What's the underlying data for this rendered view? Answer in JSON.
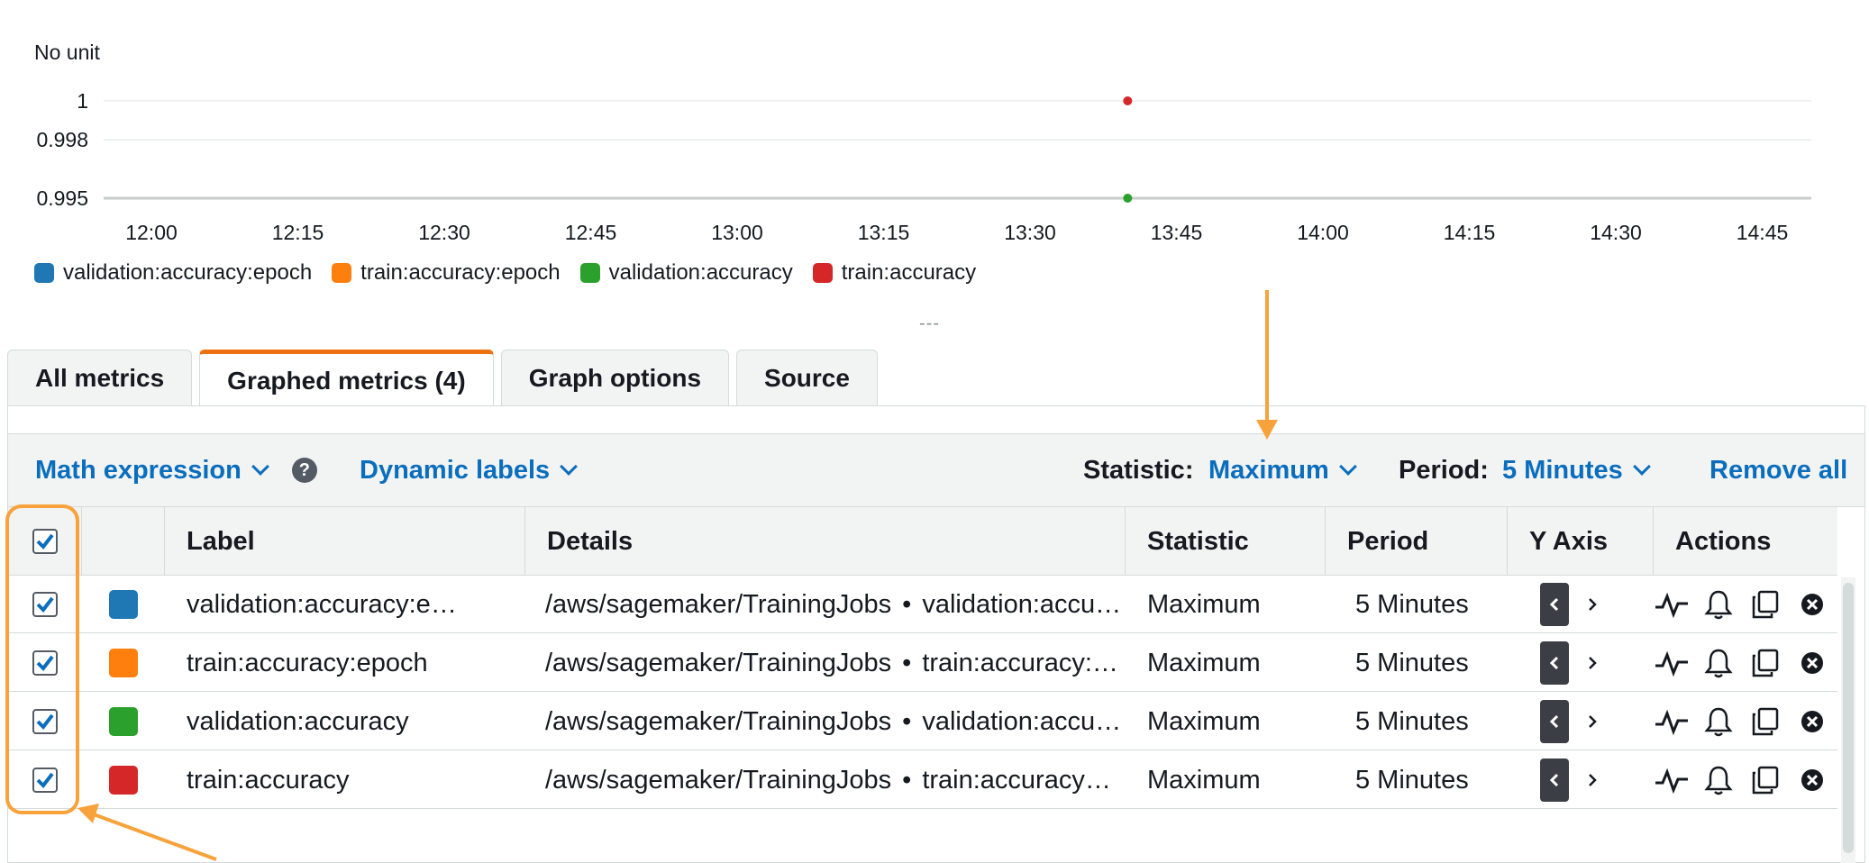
{
  "chart": {
    "unit_label": "No unit",
    "y_ticks": [
      "1",
      "0.998",
      "0.995"
    ],
    "x_ticks": [
      "12:00",
      "12:15",
      "12:30",
      "12:45",
      "13:00",
      "13:15",
      "13:30",
      "13:45",
      "14:00",
      "14:15",
      "14:30",
      "14:45"
    ]
  },
  "chart_data": {
    "type": "scatter",
    "x_ticks": [
      "12:00",
      "12:15",
      "12:30",
      "12:45",
      "13:00",
      "13:15",
      "13:30",
      "13:45",
      "14:00",
      "14:15",
      "14:30",
      "14:45"
    ],
    "y_ticks": [
      1,
      0.998,
      0.995
    ],
    "ylabel": "No unit",
    "series": [
      {
        "name": "validation:accuracy:epoch",
        "color": "#1f77b4",
        "points": []
      },
      {
        "name": "train:accuracy:epoch",
        "color": "#ff7f0e",
        "points": []
      },
      {
        "name": "validation:accuracy",
        "color": "#2ca02c",
        "points": [
          {
            "x": "13:40",
            "y": 0.995
          }
        ]
      },
      {
        "name": "train:accuracy",
        "color": "#d62728",
        "points": [
          {
            "x": "13:40",
            "y": 1
          }
        ]
      }
    ],
    "grid": true,
    "legend": "bottom-left"
  },
  "legend": [
    {
      "label": "validation:accuracy:epoch",
      "color": "#1f77b4"
    },
    {
      "label": "train:accuracy:epoch",
      "color": "#ff7f0e"
    },
    {
      "label": "validation:accuracy",
      "color": "#2ca02c"
    },
    {
      "label": "train:accuracy",
      "color": "#d62728"
    }
  ],
  "resize_grip": "---",
  "tabs": [
    {
      "label": "All metrics"
    },
    {
      "label": "Graphed metrics (4)"
    },
    {
      "label": "Graph options"
    },
    {
      "label": "Source"
    }
  ],
  "toolbar": {
    "math_expression": "Math expression",
    "dynamic_labels": "Dynamic labels",
    "statistic_label": "Statistic:",
    "statistic_value": "Maximum",
    "period_label": "Period:",
    "period_value": "5 Minutes",
    "remove_all": "Remove all",
    "help_glyph": "?"
  },
  "table": {
    "headers": {
      "label": "Label",
      "details": "Details",
      "statistic": "Statistic",
      "period": "Period",
      "y_axis": "Y Axis",
      "actions": "Actions"
    },
    "rows": [
      {
        "color": "#1f77b4",
        "label": "validation:accuracy:e…",
        "namespace": "/aws/sagemaker/TrainingJobs",
        "metric": "validation:accu…",
        "statistic": "Maximum",
        "period": "5 Minutes"
      },
      {
        "color": "#ff7f0e",
        "label": "train:accuracy:epoch",
        "namespace": "/aws/sagemaker/TrainingJobs",
        "metric": "train:accuracy:…",
        "statistic": "Maximum",
        "period": "5 Minutes"
      },
      {
        "color": "#2ca02c",
        "label": "validation:accuracy",
        "namespace": "/aws/sagemaker/TrainingJobs",
        "metric": "validation:accu…",
        "statistic": "Maximum",
        "period": "5 Minutes"
      },
      {
        "color": "#d62728",
        "label": "train:accuracy",
        "namespace": "/aws/sagemaker/TrainingJobs",
        "metric": "train:accuracy…",
        "statistic": "Maximum",
        "period": "5 Minutes"
      }
    ]
  },
  "colors": {
    "accent": "#ec7211",
    "link": "#0a6ebd",
    "annotation": "#f7a23b"
  }
}
